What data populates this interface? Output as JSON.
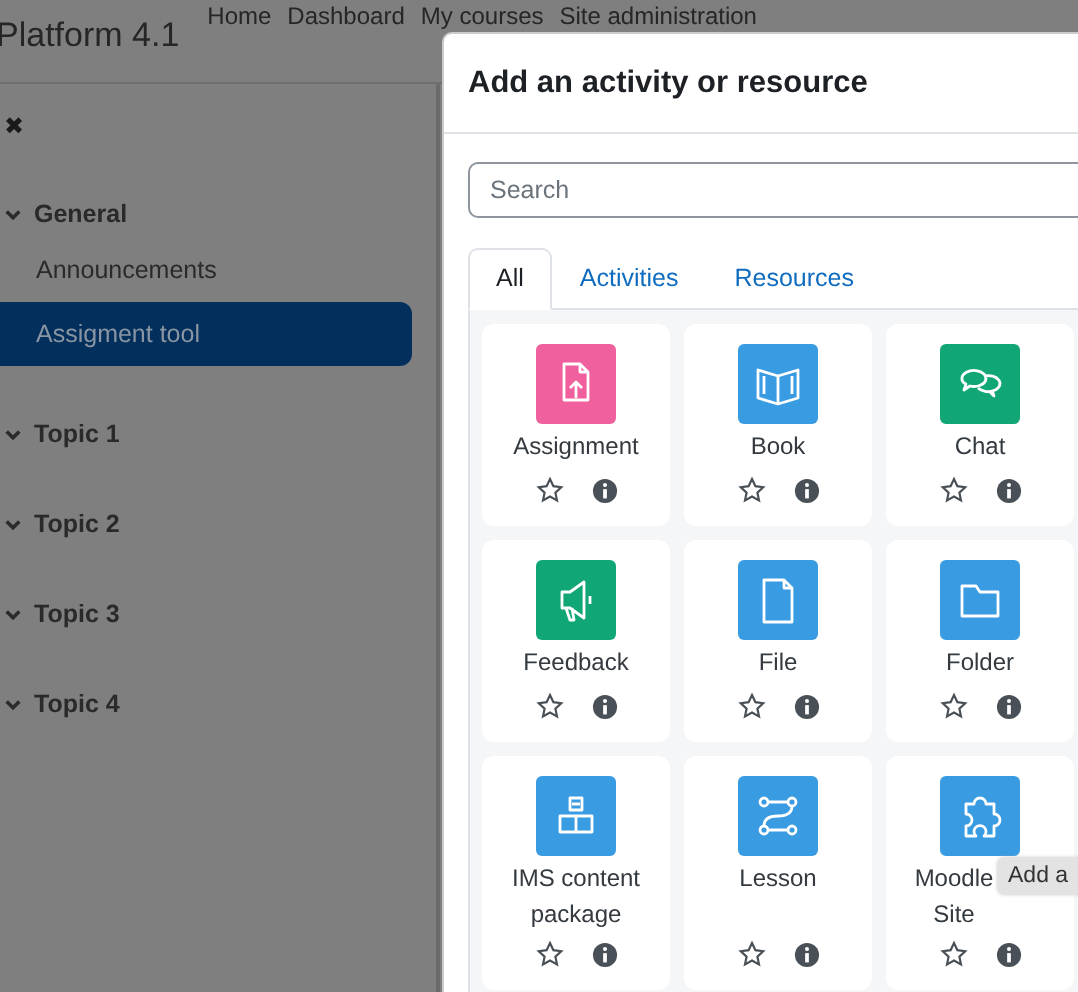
{
  "header": {
    "brand": "Platform 4.1",
    "nav": [
      "Home",
      "Dashboard",
      "My courses",
      "Site administration"
    ]
  },
  "sidebar": {
    "close": "✖",
    "items": [
      {
        "kind": "section",
        "label": "General",
        "selected": false
      },
      {
        "kind": "link",
        "label": "Announcements",
        "selected": false
      },
      {
        "kind": "link",
        "label": "Assigment tool",
        "selected": true
      },
      {
        "kind": "section",
        "label": "Topic 1",
        "selected": false
      },
      {
        "kind": "section",
        "label": "Topic 2",
        "selected": false
      },
      {
        "kind": "section",
        "label": "Topic 3",
        "selected": false
      },
      {
        "kind": "section",
        "label": "Topic 4",
        "selected": false
      }
    ]
  },
  "modal": {
    "title": "Add an activity or resource",
    "search": {
      "placeholder": "Search"
    },
    "tabs": [
      {
        "label": "All",
        "selected": true
      },
      {
        "label": "Activities",
        "selected": false
      },
      {
        "label": "Resources",
        "selected": false
      }
    ],
    "modules": [
      {
        "name": "Assignment",
        "color": "#f0609e"
      },
      {
        "name": "Book",
        "color": "#399be2"
      },
      {
        "name": "Chat",
        "color": "#11a676"
      },
      {
        "name": "Feedback",
        "color": "#11a676"
      },
      {
        "name": "File",
        "color": "#399be2"
      },
      {
        "name": "Folder",
        "color": "#399be2"
      },
      {
        "name": "IMS content package",
        "color": "#399be2"
      },
      {
        "name": "Lesson",
        "color": "#399be2"
      },
      {
        "name": "Moodle Site",
        "color": "#399be2"
      }
    ],
    "tooltip": "Add a"
  }
}
